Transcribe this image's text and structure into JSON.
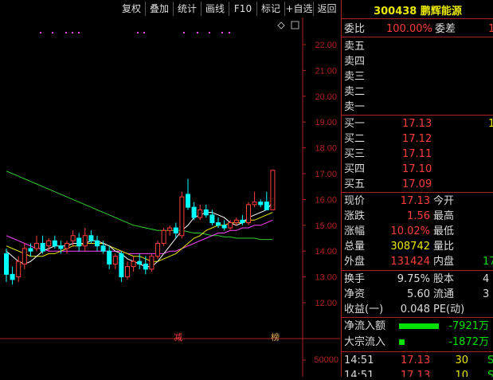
{
  "toolbar": {
    "buttons": [
      "复权",
      "叠加",
      "统计",
      "画线",
      "F10",
      "标记",
      "+自选",
      "返回"
    ]
  },
  "chart": {
    "price_ticks": [
      "22.00",
      "21.00",
      "20.00",
      "19.00",
      "18.00",
      "17.00",
      "16.00",
      "15.00",
      "14.00",
      "13.00",
      "12.00"
    ],
    "volume_tick": "50000",
    "markers": [
      "减",
      "榜"
    ],
    "colors": {
      "up": "#ff3d3d",
      "down": "#00ffff",
      "ma5": "#ffffff",
      "ma10": "#e8e800",
      "ma20": "#ff44ff",
      "ma60": "#33cc33",
      "axis": "#b02020"
    }
  },
  "chart_data": {
    "type": "candlestick",
    "ylim": [
      11.5,
      22.5
    ],
    "candles": [
      {
        "o": 13.9,
        "h": 14.1,
        "l": 12.8,
        "c": 13.1
      },
      {
        "o": 13.1,
        "h": 13.4,
        "l": 12.7,
        "c": 12.9
      },
      {
        "o": 13.0,
        "h": 13.8,
        "l": 12.8,
        "c": 13.6
      },
      {
        "o": 13.5,
        "h": 14.3,
        "l": 13.3,
        "c": 14.1
      },
      {
        "o": 14.1,
        "h": 14.3,
        "l": 13.8,
        "c": 14.0
      },
      {
        "o": 14.1,
        "h": 14.6,
        "l": 14.0,
        "c": 14.3
      },
      {
        "o": 14.3,
        "h": 14.6,
        "l": 13.9,
        "c": 14.0
      },
      {
        "o": 14.2,
        "h": 14.5,
        "l": 14.0,
        "c": 14.4
      },
      {
        "o": 14.4,
        "h": 14.6,
        "l": 14.1,
        "c": 14.2
      },
      {
        "o": 14.2,
        "h": 14.4,
        "l": 13.9,
        "c": 14.1
      },
      {
        "o": 14.1,
        "h": 14.4,
        "l": 13.9,
        "c": 14.3
      },
      {
        "o": 14.4,
        "h": 14.8,
        "l": 14.2,
        "c": 14.6
      },
      {
        "o": 14.5,
        "h": 14.7,
        "l": 14.0,
        "c": 14.2
      },
      {
        "o": 14.2,
        "h": 14.9,
        "l": 14.0,
        "c": 14.6
      },
      {
        "o": 14.6,
        "h": 14.8,
        "l": 14.3,
        "c": 14.4
      },
      {
        "o": 14.4,
        "h": 14.6,
        "l": 14.0,
        "c": 14.2
      },
      {
        "o": 14.2,
        "h": 14.4,
        "l": 13.9,
        "c": 14.0
      },
      {
        "o": 14.0,
        "h": 14.2,
        "l": 13.3,
        "c": 13.5
      },
      {
        "o": 13.5,
        "h": 13.9,
        "l": 13.3,
        "c": 13.8
      },
      {
        "o": 13.9,
        "h": 14.0,
        "l": 12.8,
        "c": 13.0
      },
      {
        "o": 13.0,
        "h": 13.6,
        "l": 12.9,
        "c": 13.4
      },
      {
        "o": 13.4,
        "h": 13.8,
        "l": 13.2,
        "c": 13.6
      },
      {
        "o": 13.6,
        "h": 13.9,
        "l": 13.3,
        "c": 13.5
      },
      {
        "o": 13.5,
        "h": 13.8,
        "l": 13.1,
        "c": 13.3
      },
      {
        "o": 13.3,
        "h": 13.9,
        "l": 13.2,
        "c": 13.8
      },
      {
        "o": 13.8,
        "h": 14.4,
        "l": 13.7,
        "c": 14.3
      },
      {
        "o": 14.3,
        "h": 14.9,
        "l": 14.2,
        "c": 14.8
      },
      {
        "o": 14.8,
        "h": 15.0,
        "l": 14.6,
        "c": 14.9
      },
      {
        "o": 14.9,
        "h": 15.1,
        "l": 14.5,
        "c": 14.7
      },
      {
        "o": 14.6,
        "h": 16.3,
        "l": 14.5,
        "c": 16.1
      },
      {
        "o": 16.2,
        "h": 16.8,
        "l": 15.6,
        "c": 15.7
      },
      {
        "o": 15.7,
        "h": 15.9,
        "l": 15.2,
        "c": 15.3
      },
      {
        "o": 15.3,
        "h": 15.8,
        "l": 15.2,
        "c": 15.6
      },
      {
        "o": 15.6,
        "h": 15.8,
        "l": 15.3,
        "c": 15.4
      },
      {
        "o": 15.4,
        "h": 15.6,
        "l": 15.0,
        "c": 15.1
      },
      {
        "o": 15.1,
        "h": 15.3,
        "l": 14.9,
        "c": 15.0
      },
      {
        "o": 15.0,
        "h": 15.2,
        "l": 14.8,
        "c": 14.9
      },
      {
        "o": 14.9,
        "h": 15.2,
        "l": 14.8,
        "c": 15.1
      },
      {
        "o": 15.1,
        "h": 15.3,
        "l": 15.0,
        "c": 15.2
      },
      {
        "o": 15.2,
        "h": 15.4,
        "l": 15.0,
        "c": 15.1
      },
      {
        "o": 15.1,
        "h": 15.9,
        "l": 15.0,
        "c": 15.8
      },
      {
        "o": 15.8,
        "h": 16.3,
        "l": 15.7,
        "c": 15.9
      },
      {
        "o": 15.9,
        "h": 16.0,
        "l": 15.7,
        "c": 15.8
      },
      {
        "o": 15.9,
        "h": 16.3,
        "l": 15.6,
        "c": 15.6
      },
      {
        "o": 15.6,
        "h": 17.13,
        "l": 15.6,
        "c": 17.13
      }
    ],
    "ma_lines": {
      "ma5": [
        14.0,
        13.8,
        13.6,
        13.5,
        13.6,
        13.8,
        14.0,
        14.1,
        14.2,
        14.2,
        14.2,
        14.3,
        14.3,
        14.3,
        14.4,
        14.4,
        14.3,
        14.2,
        14.0,
        13.9,
        13.7,
        13.6,
        13.5,
        13.4,
        13.4,
        13.6,
        13.9,
        14.2,
        14.5,
        14.8,
        15.0,
        15.3,
        15.4,
        15.5,
        15.5,
        15.4,
        15.3,
        15.1,
        15.0,
        15.1,
        15.3,
        15.4,
        15.5,
        15.6,
        15.9
      ],
      "ma10": [
        14.2,
        14.1,
        14.0,
        13.9,
        13.8,
        13.8,
        13.8,
        13.9,
        13.9,
        14.0,
        14.1,
        14.2,
        14.2,
        14.3,
        14.3,
        14.3,
        14.3,
        14.2,
        14.1,
        14.0,
        13.9,
        13.8,
        13.8,
        13.7,
        13.6,
        13.6,
        13.7,
        13.8,
        13.9,
        14.1,
        14.3,
        14.5,
        14.6,
        14.8,
        14.9,
        15.0,
        15.0,
        15.1,
        15.1,
        15.1,
        15.2,
        15.2,
        15.3,
        15.4,
        15.5
      ],
      "ma20": [
        14.6,
        14.5,
        14.4,
        14.3,
        14.2,
        14.1,
        14.1,
        14.0,
        14.0,
        14.0,
        14.0,
        14.0,
        14.0,
        14.0,
        14.0,
        14.0,
        14.0,
        14.0,
        14.0,
        14.0,
        13.9,
        13.9,
        13.9,
        13.9,
        13.9,
        13.9,
        13.9,
        14.0,
        14.0,
        14.1,
        14.2,
        14.3,
        14.4,
        14.5,
        14.6,
        14.7,
        14.7,
        14.8,
        14.8,
        14.9,
        14.9,
        15.0,
        15.0,
        15.1,
        15.2
      ],
      "ma60": [
        17.1,
        17.0,
        16.9,
        16.8,
        16.7,
        16.6,
        16.5,
        16.4,
        16.3,
        16.2,
        16.1,
        16.0,
        15.9,
        15.8,
        15.7,
        15.6,
        15.5,
        15.4,
        15.3,
        15.2,
        15.1,
        15.0,
        14.95,
        14.9,
        14.85,
        14.8,
        14.8,
        14.8,
        14.8,
        14.8,
        14.75,
        14.7,
        14.7,
        14.65,
        14.6,
        14.6,
        14.55,
        14.55,
        14.5,
        14.5,
        14.5,
        14.5,
        14.45,
        14.45,
        14.45
      ]
    }
  },
  "quote": {
    "code": "300438",
    "name": "鹏辉能源",
    "weibi_label": "委比",
    "weibi_value": "100.00%",
    "weicha_label": "委差",
    "weicha_value": "1",
    "sell": [
      {
        "label": "卖五",
        "price": "",
        "vol": ""
      },
      {
        "label": "卖四",
        "price": "",
        "vol": ""
      },
      {
        "label": "卖三",
        "price": "",
        "vol": ""
      },
      {
        "label": "卖二",
        "price": "",
        "vol": ""
      },
      {
        "label": "卖一",
        "price": "",
        "vol": ""
      }
    ],
    "buy": [
      {
        "label": "买一",
        "price": "17.13",
        "vol": "1"
      },
      {
        "label": "买二",
        "price": "17.12",
        "vol": ""
      },
      {
        "label": "买三",
        "price": "17.11",
        "vol": ""
      },
      {
        "label": "买四",
        "price": "17.10",
        "vol": ""
      },
      {
        "label": "买五",
        "price": "17.09",
        "vol": ""
      }
    ],
    "stats": [
      {
        "l1": "现价",
        "v1": "17.13",
        "c1": "red",
        "l2": "今开",
        "v2": "",
        "c2": "red"
      },
      {
        "l1": "涨跌",
        "v1": "1.56",
        "c1": "red",
        "l2": "最高",
        "v2": "",
        "c2": "red"
      },
      {
        "l1": "涨幅",
        "v1": "10.02%",
        "c1": "red",
        "l2": "最低",
        "v2": "",
        "c2": "red"
      },
      {
        "l1": "总量",
        "v1": "308742",
        "c1": "yellow",
        "l2": "量比",
        "v2": "",
        "c2": "red"
      },
      {
        "l1": "外盘",
        "v1": "131424",
        "c1": "red",
        "l2": "内盘",
        "v2": "17",
        "c2": "green"
      }
    ],
    "stats2": [
      {
        "l1": "换手",
        "v1": "9.75%",
        "c1": "lbl",
        "l2": "股本",
        "v2": "4",
        "c2": "lbl"
      },
      {
        "l1": "净资",
        "v1": "5.60",
        "c1": "lbl",
        "l2": "流通",
        "v2": "3",
        "c2": "lbl"
      },
      {
        "l1": "收益(一)",
        "v1": "0.048",
        "c1": "lbl",
        "l2": "PE(动)",
        "v2": "",
        "c2": "lbl"
      }
    ],
    "flows": [
      {
        "label": "净流入额",
        "value": "-7921万",
        "bar": 0.55
      },
      {
        "label": "大宗流入",
        "value": "-1872万",
        "bar": 0.08
      }
    ],
    "ticks": [
      {
        "time": "14:51",
        "price": "17.13",
        "vol": "30",
        "flag": "S"
      },
      {
        "time": "14:51",
        "price": "17.13",
        "vol": "10",
        "flag": "S"
      }
    ]
  }
}
